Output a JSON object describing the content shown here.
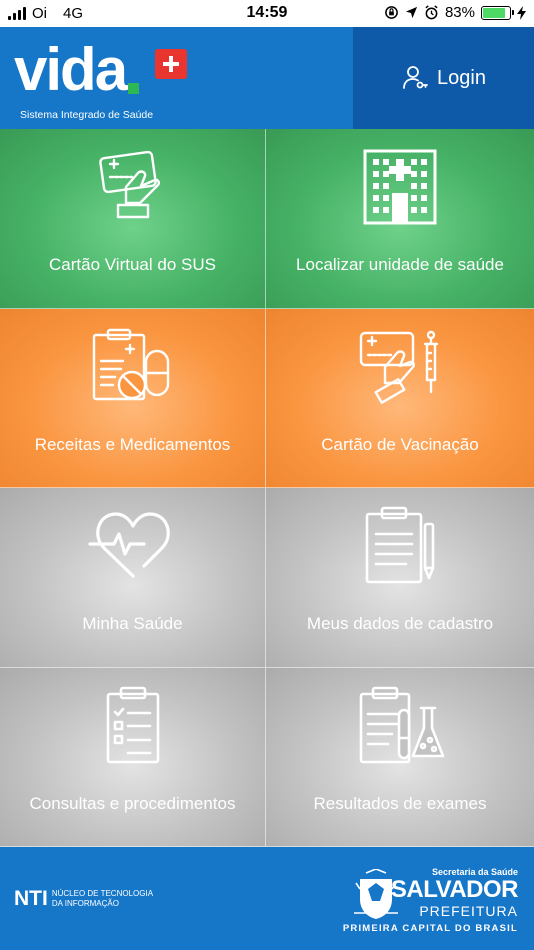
{
  "status_bar": {
    "carrier": "Oi",
    "network": "4G",
    "time": "14:59",
    "battery": "83%",
    "battery_level": 0.83
  },
  "header": {
    "brand_word": "vida",
    "tagline": "Sistema Integrado de Saúde",
    "login_label": "Login",
    "colors": {
      "bar": "#1676c8",
      "login": "#0e5aa8",
      "cross": "#e8352f",
      "dot": "#2eb855"
    }
  },
  "menu": [
    {
      "label": "Cartão Virtual do SUS",
      "icon": "card-hand-icon",
      "color": "green"
    },
    {
      "label": "Localizar unidade de saúde",
      "icon": "hospital-building-icon",
      "color": "green"
    },
    {
      "label": "Receitas e Medicamentos",
      "icon": "prescription-pills-icon",
      "color": "orange"
    },
    {
      "label": "Cartão de Vacinação",
      "icon": "vaccine-card-icon",
      "color": "orange"
    },
    {
      "label": "Minha Saúde",
      "icon": "heart-pulse-icon",
      "color": "gray"
    },
    {
      "label": "Meus dados de cadastro",
      "icon": "clipboard-pen-icon",
      "color": "gray"
    },
    {
      "label": "Consultas e procedimentos",
      "icon": "clipboard-checklist-icon",
      "color": "gray"
    },
    {
      "label": "Resultados de exames",
      "icon": "clipboard-lab-icon",
      "color": "gray"
    }
  ],
  "footer": {
    "nti_big": "NTI",
    "nti_line1": "NÚCLEO DE TECNOLOGIA",
    "nti_line2": "DA INFORMAÇÃO",
    "secretaria": "Secretaria da Saúde",
    "city": "SALVADOR",
    "prefeitura": "PREFEITURA",
    "slogan": "PRIMEIRA CAPITAL DO BRASIL"
  }
}
